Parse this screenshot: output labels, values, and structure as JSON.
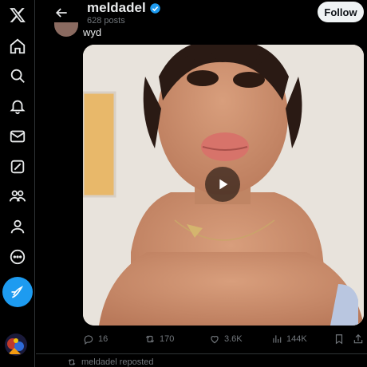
{
  "header": {
    "title": "meldadel",
    "post_count": "628 posts",
    "follow_label": "Follow"
  },
  "post": {
    "text": "wyd",
    "replies": "16",
    "reposts": "170",
    "likes": "3.6K",
    "views": "144K"
  },
  "footer": {
    "repost_note": "meldadel reposted"
  },
  "sidebar": {
    "icons": [
      "x-logo-icon",
      "home-icon",
      "search-icon",
      "notifications-icon",
      "messages-icon",
      "grok-icon",
      "communities-icon",
      "profile-icon",
      "more-icon",
      "compose-icon"
    ]
  },
  "colors": {
    "accent": "#1d9bf0",
    "background": "#000000",
    "text": "#e7e9ea",
    "muted": "#71767b",
    "follow_bg": "#eff3f4"
  }
}
